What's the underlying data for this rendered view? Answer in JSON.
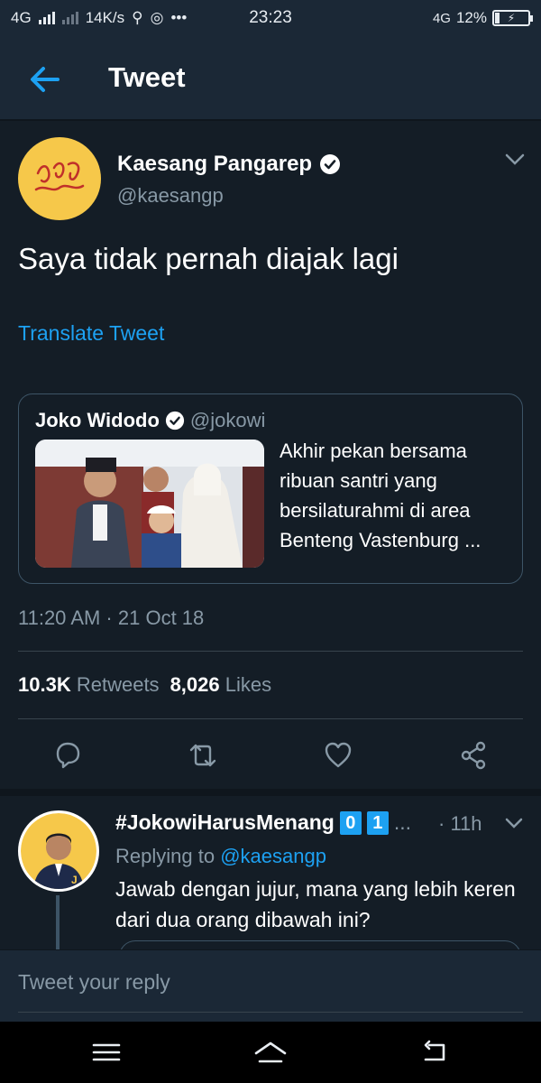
{
  "status": {
    "network": "4G",
    "speed": "14K/s",
    "time": "23:23",
    "network2": "4G",
    "battery": "12%"
  },
  "header": {
    "title": "Tweet"
  },
  "tweet": {
    "author_name": "Kaesang Pangarep",
    "author_handle": "@kaesangp",
    "text": "Saya tidak pernah diajak lagi",
    "translate_label": "Translate Tweet",
    "timestamp": "11:20 AM · 21 Oct 18",
    "retweets_count": "10.3K",
    "retweets_label": "Retweets",
    "likes_count": "8,026",
    "likes_label": "Likes"
  },
  "quoted": {
    "name": "Joko Widodo",
    "handle": "@jokowi",
    "text": "Akhir pekan bersama ribuan santri yang bersilaturahmi di area Benteng Vastenburg ..."
  },
  "reply": {
    "name": "#JokowiHarusMenang",
    "badge_1": "0",
    "badge_2": "1",
    "ellipsis": "...",
    "time": "· 11h",
    "replying_prefix": "Replying to",
    "replying_handle": "@kaesangp",
    "text": "Jawab dengan jujur, mana yang lebih keren dari dua orang dibawah ini?"
  },
  "compose": {
    "placeholder": "Tweet your reply"
  },
  "colors": {
    "background": "#141d26",
    "header": "#1b2836",
    "accent": "#1da1f2",
    "muted": "#8899a6",
    "avatar_yellow": "#f6c84a"
  },
  "icons": {
    "back": "arrow-left-icon",
    "verified": "verified-badge-icon",
    "reply": "reply-icon",
    "retweet": "retweet-icon",
    "like": "heart-icon",
    "share": "share-icon"
  }
}
